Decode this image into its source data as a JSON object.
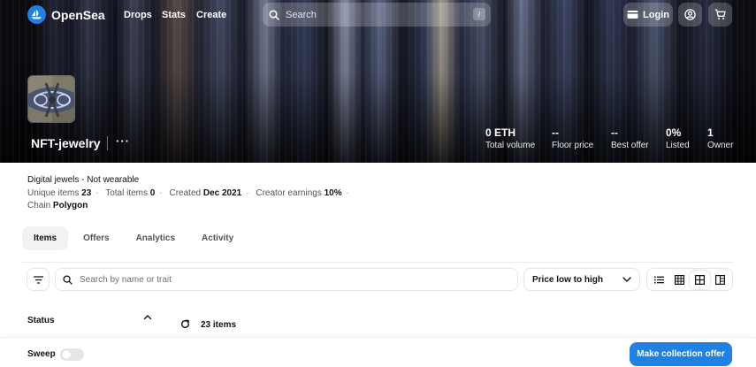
{
  "nav": {
    "brand": "OpenSea",
    "links": [
      "Drops",
      "Stats",
      "Create"
    ],
    "search_placeholder": "Search",
    "search_shortcut": "/",
    "login_label": "Login",
    "icons": [
      "wallet-icon",
      "account-icon",
      "cart-icon"
    ]
  },
  "collection": {
    "name": "NFT-jewelry",
    "more": "···",
    "stats": [
      {
        "value": "0 ETH",
        "label": "Total volume"
      },
      {
        "value": "--",
        "label": "Floor price"
      },
      {
        "value": "--",
        "label": "Best offer"
      },
      {
        "value": "0%",
        "label": "Listed"
      },
      {
        "value": "1",
        "label": "Owner"
      }
    ],
    "description": "Digital jewels - Not wearable",
    "meta": {
      "unique_items_label": "Unique items",
      "unique_items_value": "23",
      "total_items_label": "Total items",
      "total_items_value": "0",
      "created_label": "Created",
      "created_value": "Dec 2021",
      "creator_earnings_label": "Creator earnings",
      "creator_earnings_value": "10%",
      "chain_label": "Chain",
      "chain_value": "Polygon"
    }
  },
  "tabs": [
    {
      "label": "Items",
      "active": true
    },
    {
      "label": "Offers",
      "active": false
    },
    {
      "label": "Analytics",
      "active": false
    },
    {
      "label": "Activity",
      "active": false
    }
  ],
  "toolbar": {
    "search_placeholder": "Search by name or trait",
    "sort_selected": "Price low to high",
    "view_modes": [
      "list-view-icon",
      "grid-small-icon",
      "grid-medium-icon",
      "grid-large-icon"
    ],
    "active_view": "grid-medium-icon"
  },
  "sidebar": {
    "status_label": "Status"
  },
  "results": {
    "count_text": "23 items"
  },
  "footer": {
    "sweep_label": "Sweep",
    "sweep_enabled": false,
    "offer_button": "Make collection offer"
  },
  "colors": {
    "accent": "#2081e2",
    "text": "#121212",
    "muted": "#545454"
  }
}
